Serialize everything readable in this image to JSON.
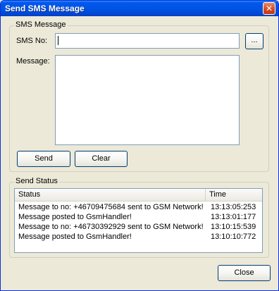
{
  "window": {
    "title": "Send SMS Message",
    "close_glyph": "✕"
  },
  "sms_group": {
    "legend": "SMS Message",
    "sms_no_label": "SMS No:",
    "sms_no_value": "",
    "browse_label": "...",
    "message_label": "Message:",
    "message_value": "",
    "send_label": "Send",
    "clear_label": "Clear"
  },
  "status_group": {
    "legend": "Send Status",
    "columns": [
      "Status",
      "Time"
    ],
    "rows": [
      {
        "status": "Message to no: +46709475684 sent to GSM Network!",
        "time": "13:13:05:253"
      },
      {
        "status": "Message posted to GsmHandler!",
        "time": "13:13:01:177"
      },
      {
        "status": "Message to no: +46730392929 sent to GSM Network!",
        "time": "13:10:15:539"
      },
      {
        "status": "Message posted to GsmHandler!",
        "time": "13:10:10:772"
      }
    ]
  },
  "footer": {
    "close_label": "Close"
  }
}
